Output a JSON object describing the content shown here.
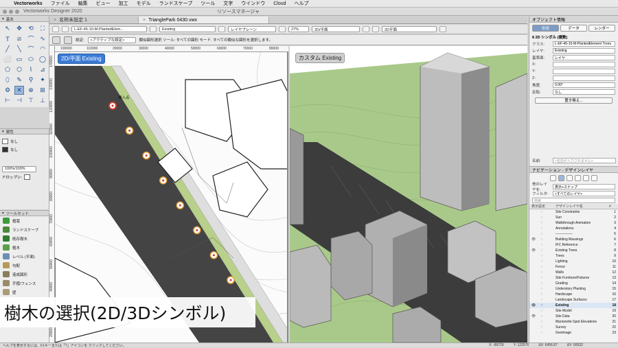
{
  "menubar": {
    "apple": "",
    "app": "Vectorworks",
    "items": [
      "ファイル",
      "編集",
      "ビュー",
      "加工",
      "モデル",
      "ランドスケープ",
      "ツール",
      "文字",
      "ウインドウ",
      "Cloud",
      "ヘルプ"
    ]
  },
  "window": {
    "title": "Vectorworks Designer 2020",
    "resource_title": "リソースマネージャ"
  },
  "tabs": [
    {
      "label": "名称未設定 1",
      "active": false
    },
    {
      "label": "TrianglePark 0430.vwx",
      "active": true
    }
  ],
  "viewbar": {
    "class_select": "L-EF-45-10-M-PlantedElem...",
    "layer_select": "Existing",
    "layer_plane": "レイヤプレーン",
    "zoom": "27%",
    "view_2d": "2D/平面",
    "view_right": "2D平面"
  },
  "infobar": {
    "settings_label": "設定:",
    "settings_value": "<アクティブな設定>",
    "mode_text": "類似図形選択 ツール: すべての図形 モード. すべての類似な図形を選択します。"
  },
  "tool_palette": {
    "title": "基本",
    "tools": [
      "↖",
      "✥",
      "⟲",
      "⛶",
      "T",
      "⧄",
      "⌒",
      "∿",
      "╱",
      "╲",
      "⌒",
      "◠",
      "⬜",
      "▭",
      "⬭",
      "◯",
      "⬠",
      "⬡",
      "⌇",
      "⊿",
      "⬯",
      "✎",
      "⚲",
      "✦",
      "⚙",
      "✕",
      "⊕",
      "⊞",
      "⊢",
      "⊣",
      "⊤",
      "⊥"
    ]
  },
  "attributes": {
    "title": "属性",
    "fill_value": "なし",
    "pen_value": "なし",
    "opacity": "100%/100%",
    "dropshadow_label": "ドロップシ:"
  },
  "toolset": {
    "title": "ツールセット",
    "items": [
      {
        "label": "植栽",
        "color": "#3d9a3d"
      },
      {
        "label": "ランドスケープ",
        "color": "#4a8a3a"
      },
      {
        "label": "既存樹木",
        "color": "#2f7d2f"
      },
      {
        "label": "植木",
        "color": "#5aa04a"
      },
      {
        "label": "レベル (平面)",
        "color": "#6a8fb3"
      },
      {
        "label": "勾配",
        "color": "#b59a5a"
      },
      {
        "label": "造成図形",
        "color": "#8a7d5a"
      },
      {
        "label": "手摺/フェンス",
        "color": "#9a8a6a"
      },
      {
        "label": "壁",
        "color": "#aa9a7a"
      }
    ]
  },
  "viewport_2d": {
    "label": "2D/平面 Existing",
    "ruler_h": [
      "100000",
      "110000",
      "20000",
      "30000",
      "40000",
      "50000",
      "60000",
      "70000",
      "80000"
    ],
    "ruler_v": [
      "140000",
      "130000",
      "120000",
      "110000",
      "100000",
      "90000",
      "80000",
      "70000",
      "60000",
      "50000",
      "40000",
      "30000",
      "20000"
    ],
    "cursor_label": "挿入点"
  },
  "viewport_3d": {
    "label": "カスタム Existing"
  },
  "caption": "樹木の選択(2D/3Dシンボル)",
  "object_info": {
    "title": "オブジェクト情報",
    "tabs": [
      "形状",
      "データ",
      "レンダー"
    ],
    "symbol_title": "8 2D シンボル (複数)",
    "class_label": "クラス:",
    "class_value": "L-EF-45-10-M-PlantedElement Trees",
    "layer_label": "レイヤ:",
    "layer_value": "Existing",
    "plane_label": "基準面:",
    "plane_value": "レイヤ",
    "x_label": "X:",
    "y_label": "Y:",
    "z_label": "Z:",
    "angle_label": "角度:",
    "angle_value": "0.00°",
    "mirror_label": "反転:",
    "mirror_value": "なし",
    "replace_button": "置き換え...",
    "name_label": "名前:",
    "name_placeholder": "<名前が入力されません>"
  },
  "navigation": {
    "title": "ナビゲーション - デザインレイヤ",
    "other_layers_label": "他のレイヤを:",
    "other_layers_value": "表示+スナップ",
    "filter_label": "フィルタ:",
    "filter_value": "<すべてのレイヤ>",
    "search_placeholder": "検索",
    "col_visibility": "表示設定",
    "col_name": "デザインレイヤ名",
    "col_number": "#",
    "layers": [
      {
        "name": "Site Constraints",
        "no": "1",
        "eye": false,
        "active": false
      },
      {
        "name": "Sun",
        "no": "2",
        "eye": false,
        "active": false
      },
      {
        "name": "Walkthrough Animation",
        "no": "3",
        "eye": false,
        "active": false
      },
      {
        "name": "Annotations",
        "no": "4",
        "eye": false,
        "active": false
      },
      {
        "name": "---------------",
        "no": "5",
        "eye": false,
        "active": false
      },
      {
        "name": "Building Massings",
        "no": "6",
        "eye": true,
        "active": false
      },
      {
        "name": "IFC Reference",
        "no": "7",
        "eye": false,
        "active": false
      },
      {
        "name": "Existing Trees",
        "no": "8",
        "eye": true,
        "active": false
      },
      {
        "name": "Trees",
        "no": "9",
        "eye": false,
        "active": false
      },
      {
        "name": "Lighting",
        "no": "10",
        "eye": false,
        "active": false
      },
      {
        "name": "Fence",
        "no": "11",
        "eye": false,
        "active": false
      },
      {
        "name": "Walls",
        "no": "12",
        "eye": false,
        "active": false
      },
      {
        "name": "Site Furniture/Fixtures",
        "no": "13",
        "eye": false,
        "active": false
      },
      {
        "name": "Grading",
        "no": "14",
        "eye": false,
        "active": false
      },
      {
        "name": "Understory Planting",
        "no": "15",
        "eye": false,
        "active": false
      },
      {
        "name": "Hardscape",
        "no": "16",
        "eye": false,
        "active": false
      },
      {
        "name": "Landscape Surfaces",
        "no": "17",
        "eye": false,
        "active": false
      },
      {
        "name": "Existing",
        "no": "18",
        "eye": true,
        "active": true
      },
      {
        "name": "Site Model",
        "no": "19",
        "eye": false,
        "active": false
      },
      {
        "name": "Site Data",
        "no": "20",
        "eye": true,
        "active": false
      },
      {
        "name": "Marionette-Spot Elevations",
        "no": "21",
        "eye": false,
        "active": false
      },
      {
        "name": "Survey",
        "no": "22",
        "eye": false,
        "active": false
      },
      {
        "name": "Geoimage",
        "no": "23",
        "eye": false,
        "active": false
      }
    ]
  },
  "status": {
    "help": "ヘルプを表示するには、F1キーまたは「?」アイコンを クリックしてください。",
    "x": "X: -89729",
    "y": "Y: 122576",
    "dx": "ΔX: 6456.87",
    "dy": "ΔY: 56532"
  },
  "colors": {
    "accent": "#3a7bd5",
    "road": "#444444",
    "green_strip": "#b8d08a",
    "terrain_3d": "#a9c98a",
    "tree_marker": "#e8a23a",
    "selected_marker": "#d83a2a"
  }
}
